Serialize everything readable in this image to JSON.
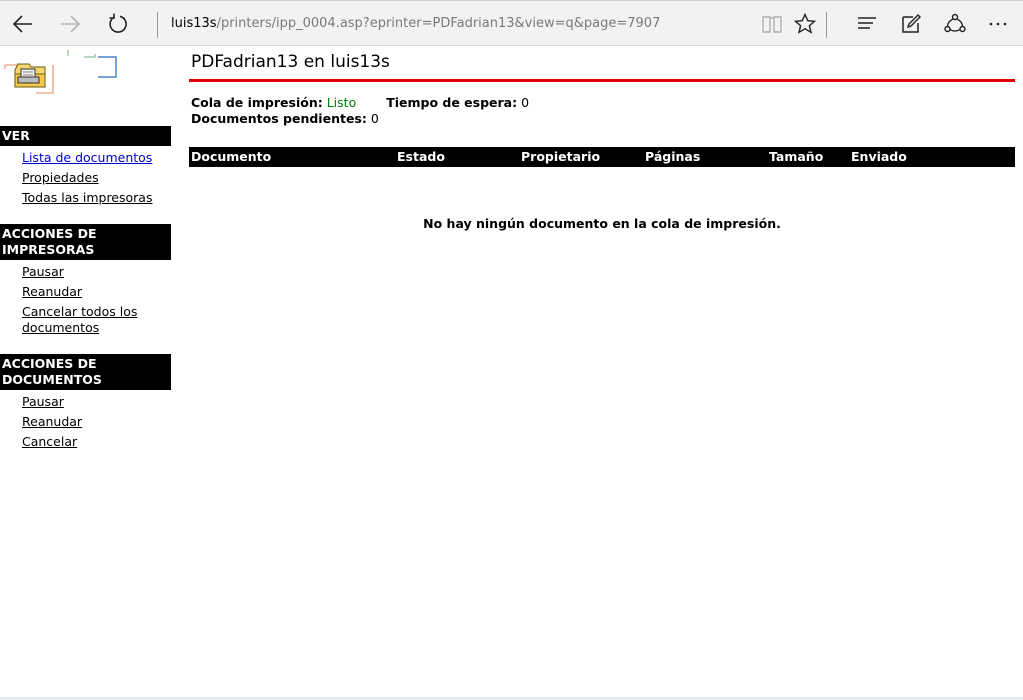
{
  "browser": {
    "url_host": "luis13s",
    "url_path": "/printers/ipp_0004.asp?eprinter=PDFadrian13&view=q&page=7907",
    "icons": [
      "back-arrow-icon",
      "forward-arrow-icon",
      "refresh-icon",
      "reading-view-icon",
      "favorite-star-icon",
      "hub-icon",
      "web-note-icon",
      "share-icon",
      "more-icon"
    ]
  },
  "sidebar": {
    "sections": [
      {
        "title": "VER",
        "items": [
          "Lista de documentos",
          "Propiedades",
          "Todas las impresoras"
        ]
      },
      {
        "title": "ACCIONES DE IMPRESORAS",
        "items": [
          "Pausar",
          "Reanudar",
          "Cancelar todos los documentos"
        ]
      },
      {
        "title": "ACCIONES DE DOCUMENTOS",
        "items": [
          "Pausar",
          "Reanudar",
          "Cancelar"
        ]
      }
    ]
  },
  "main": {
    "title": "PDFadrian13 en luis13s",
    "queue_label": "Cola de impresión:",
    "queue_value": "Listo",
    "wait_label": "Tiempo de espera:",
    "wait_value": "0",
    "pending_label": "Documentos pendientes:",
    "pending_value": "0",
    "columns": [
      "Documento",
      "Estado",
      "Propietario",
      "Páginas",
      "Tamaño",
      "Enviado"
    ],
    "empty_message": "No hay ningún documento en la cola de impresión."
  },
  "colors": {
    "accent_rule": "#e00000",
    "status_ok": "#008000",
    "active_link": "#0000cc"
  }
}
